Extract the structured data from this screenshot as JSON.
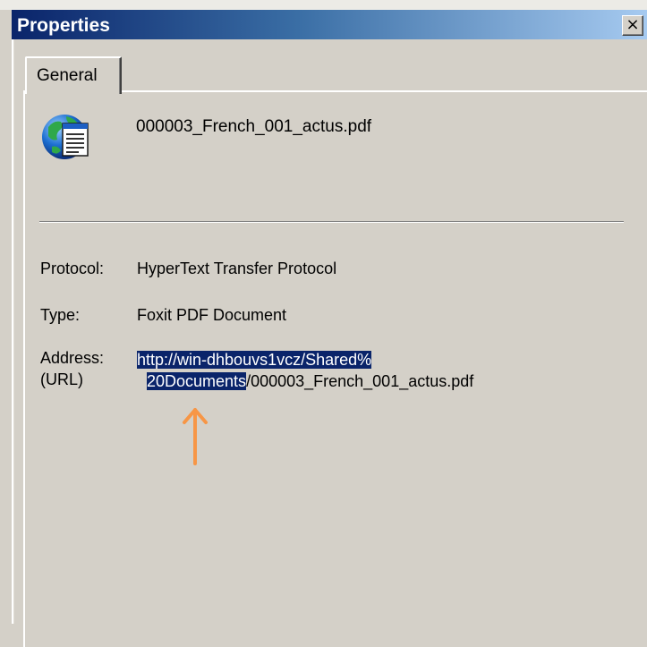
{
  "window": {
    "title": "Properties",
    "close_glyph": "×"
  },
  "tabs": [
    {
      "label": "General",
      "active": true
    }
  ],
  "general": {
    "file_icon": "web-document-icon",
    "filename": "000003_French_001_actus.pdf",
    "protocol": {
      "label": "Protocol:",
      "value": "HyperText Transfer Protocol"
    },
    "type": {
      "label": "Type:",
      "value": "Foxit PDF Document"
    },
    "address": {
      "label_line1": "Address:",
      "label_line2": "(URL)",
      "line1_selected": "http://win-dhbouvs1vcz/Shared%",
      "line2_selected": "20Documents",
      "line2_rest": "/000003_French_001_actus.pdf"
    }
  },
  "annotation": {
    "icon": "arrow-up-icon",
    "color": "#f79646"
  },
  "colors": {
    "title_gradient_start": "#0a246a",
    "title_gradient_end": "#a6caf0",
    "selection_bg": "#0a246a",
    "dialog_bg": "#d4d0c8"
  }
}
